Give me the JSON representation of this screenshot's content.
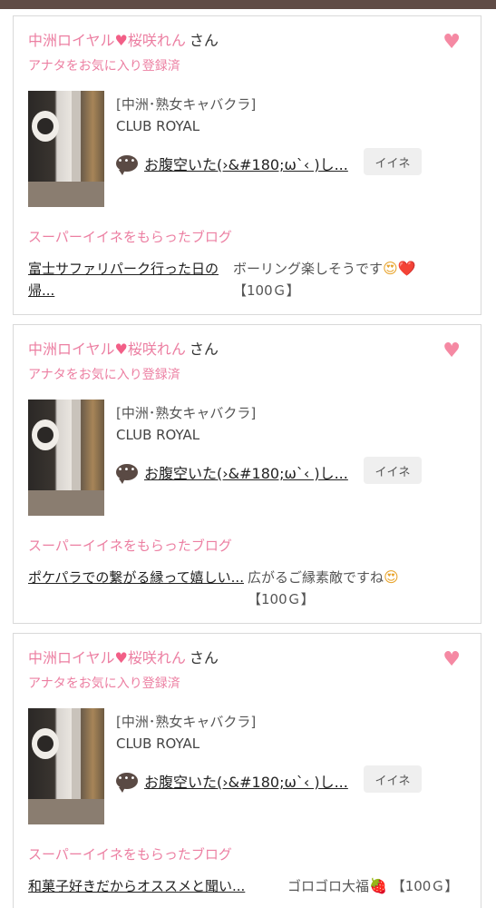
{
  "cards": [
    {
      "shop": "中洲ロイヤル",
      "heart": "♥",
      "cast": "桜咲れん",
      "san": "さん",
      "fav_status": "アナタをお気に入り登録済",
      "fav_heart": "♥",
      "category": "[中洲･熟女キャバクラ]",
      "club": "CLUB ROYAL",
      "blog_title": "お腹空いた(›&#180;ω`‹ )し...",
      "iine": "イイネ",
      "super_label": "スーパーイイネをもらったブログ",
      "praised_title": "富士サファリパーク行った日の帰...",
      "comment_text": "ボーリング楽しそうです",
      "comment_emoji1": "😍",
      "comment_emoji2": "❤️",
      "comment_after": "",
      "points": "【100Ｇ】"
    },
    {
      "shop": "中洲ロイヤル",
      "heart": "♥",
      "cast": "桜咲れん",
      "san": "さん",
      "fav_status": "アナタをお気に入り登録済",
      "fav_heart": "♥",
      "category": "[中洲･熟女キャバクラ]",
      "club": "CLUB ROYAL",
      "blog_title": "お腹空いた(›&#180;ω`‹ )し...",
      "iine": "イイネ",
      "super_label": "スーパーイイネをもらったブログ",
      "praised_title": "ポケパラでの繋がる縁って嬉しい...",
      "comment_text": "広がるご縁素敵ですね",
      "comment_emoji1": "😍",
      "comment_emoji2": "",
      "comment_after": "",
      "points": "【100Ｇ】"
    },
    {
      "shop": "中洲ロイヤル",
      "heart": "♥",
      "cast": "桜咲れん",
      "san": "さん",
      "fav_status": "アナタをお気に入り登録済",
      "fav_heart": "♥",
      "category": "[中洲･熟女キャバクラ]",
      "club": "CLUB ROYAL",
      "blog_title": "お腹空いた(›&#180;ω`‹ )し...",
      "iine": "イイネ",
      "super_label": "スーパーイイネをもらったブログ",
      "praised_title": "和菓子好きだからオススメと聞い...",
      "comment_text": "ゴロゴロ大福",
      "comment_emoji1": "🍓",
      "comment_emoji2": "",
      "comment_after": "",
      "points": "【100Ｇ】"
    }
  ],
  "colors": {
    "accent_pink": "#ec7fa2",
    "heart_pink": "#f589a3",
    "topbar": "#5f4b45"
  },
  "icons": [
    "heart-icon",
    "speech-bubble-icon",
    "favorite-heart-icon"
  ]
}
